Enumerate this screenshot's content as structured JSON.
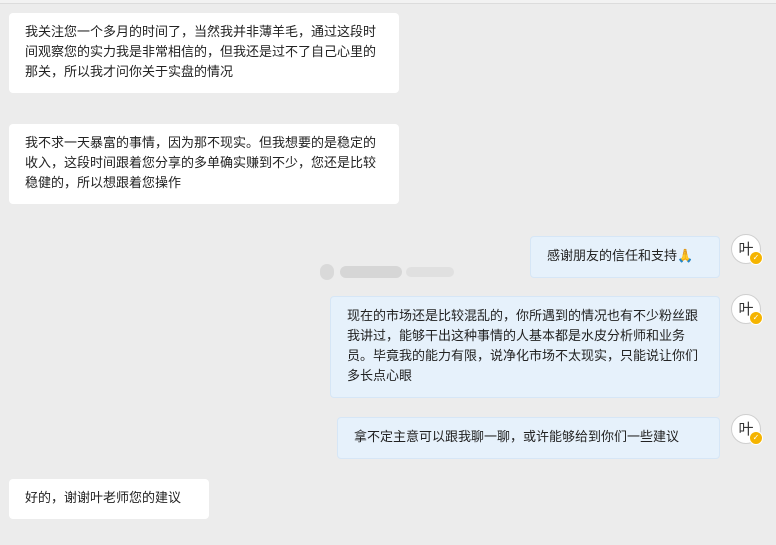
{
  "messages": [
    {
      "id": "m1",
      "side": "in",
      "text": "我关注您一个多月的时间了，当然我并非薄羊毛，通过这段时间观察您的实力我是非常相信的，但我还是过不了自己心里的那关，所以我才问你关于实盘的情况"
    },
    {
      "id": "m2",
      "side": "in",
      "text": "我不求一天暴富的事情，因为那不现实。但我想要的是稳定的收入，这段时间跟着您分享的多单确实赚到不少，您还是比较稳健的，所以想跟着您操作"
    },
    {
      "id": "m3",
      "side": "out",
      "text": "感谢朋友的信任和支持🙏"
    },
    {
      "id": "m4",
      "side": "out",
      "text": "现在的市场还是比较混乱的，你所遇到的情况也有不少粉丝跟我讲过，能够干出这种事情的人基本都是水皮分析师和业务员。毕竟我的能力有限，说净化市场不太现实，只能说让你们多长点心眼"
    },
    {
      "id": "m5",
      "side": "out",
      "text": "拿不定主意可以跟我聊一聊，或许能够给到你们一些建议"
    },
    {
      "id": "m6",
      "side": "in",
      "text": "好的，谢谢叶老师您的建议"
    }
  ],
  "avatar": {
    "glyph": "叶",
    "icon": "ink-calligraphy-avatar-icon",
    "badge_color": "#f5b400"
  },
  "colors": {
    "background": "#ececec",
    "incoming_bubble": "#ffffff",
    "outgoing_bubble": "#e6f1fb"
  }
}
